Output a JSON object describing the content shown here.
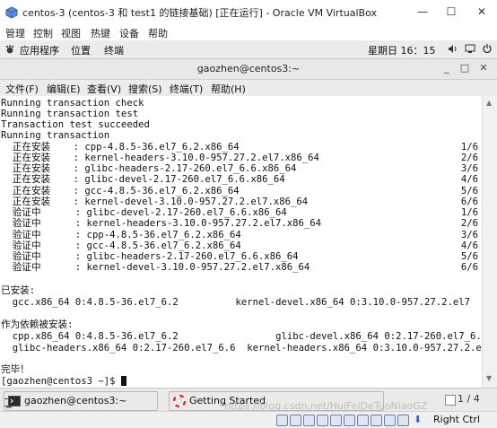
{
  "window": {
    "title": "centos-3 (centos-3 和 test1 的链接基础) [正在运行] - Oracle VM VirtualBox",
    "minimize_glyph": "—",
    "maximize_glyph": "☐",
    "close_glyph": "✕"
  },
  "vbox_menu": {
    "items": [
      "管理",
      "控制",
      "视图",
      "热键",
      "设备",
      "帮助"
    ]
  },
  "gnome_panel": {
    "applications": "应用程序",
    "places": "位置",
    "terminal": "终端",
    "clock": "星期日 16：15"
  },
  "terminal": {
    "title": "gaozhen@centos3:~",
    "menu": [
      "文件(F)",
      "编辑(E)",
      "查看(V)",
      "搜索(S)",
      "终端(T)",
      "帮助(H)"
    ],
    "lines": [
      "Running transaction check",
      "Running transaction test",
      "Transaction test succeeded",
      "Running transaction",
      "  正在安装    : cpp-4.8.5-36.el7_6.2.x86_64",
      "  正在安装    : kernel-headers-3.10.0-957.27.2.el7.x86_64",
      "  正在安装    : glibc-headers-2.17-260.el7_6.6.x86_64",
      "  正在安装    : glibc-devel-2.17-260.el7_6.6.x86_64",
      "  正在安装    : gcc-4.8.5-36.el7_6.2.x86_64",
      "  正在安装    : kernel-devel-3.10.0-957.27.2.el7.x86_64",
      "  验证中      : glibc-devel-2.17-260.el7_6.6.x86_64",
      "  验证中      : kernel-headers-3.10.0-957.27.2.el7.x86_64",
      "  验证中      : cpp-4.8.5-36.el7_6.2.x86_64",
      "  验证中      : gcc-4.8.5-36.el7_6.2.x86_64",
      "  验证中      : glibc-headers-2.17-260.el7_6.6.x86_64",
      "  验证中      : kernel-devel-3.10.0-957.27.2.el7.x86_64",
      "",
      "已安装:",
      "  gcc.x86_64 0:4.8.5-36.el7_6.2          kernel-devel.x86_64 0:3.10.0-957.27.2.el7",
      "",
      "作为依赖被安装:",
      "  cpp.x86_64 0:4.8.5-36.el7_6.2                 glibc-devel.x86_64 0:2.17-260.el7_6.6",
      "  glibc-headers.x86_64 0:2.17-260.el7_6.6  kernel-headers.x86_64 0:3.10.0-957.27.2.el7",
      "",
      "完毕！",
      "[gaozhen@centos3 ~]$ "
    ],
    "progress": [
      "1/6",
      "2/6",
      "3/6",
      "4/6",
      "5/6",
      "6/6",
      "1/6",
      "2/6",
      "3/6",
      "4/6",
      "5/6",
      "6/6"
    ]
  },
  "taskbar": {
    "tasks": [
      {
        "label": "gaozhen@centos3:~"
      },
      {
        "label": "Getting Started"
      }
    ],
    "workspace": "1 / 4"
  },
  "status_bar": {
    "host_key": "Right Ctrl",
    "watermark": "https://blog.csdn.net/HuiFeiDeTuoNiaoGZ"
  },
  "colors": {
    "panel": "#edeceb",
    "terminal_bg": "#ffffff",
    "terminal_fg": "#111111",
    "vbox_icon": "#2f63b8",
    "help_icon": "#d9342b"
  }
}
